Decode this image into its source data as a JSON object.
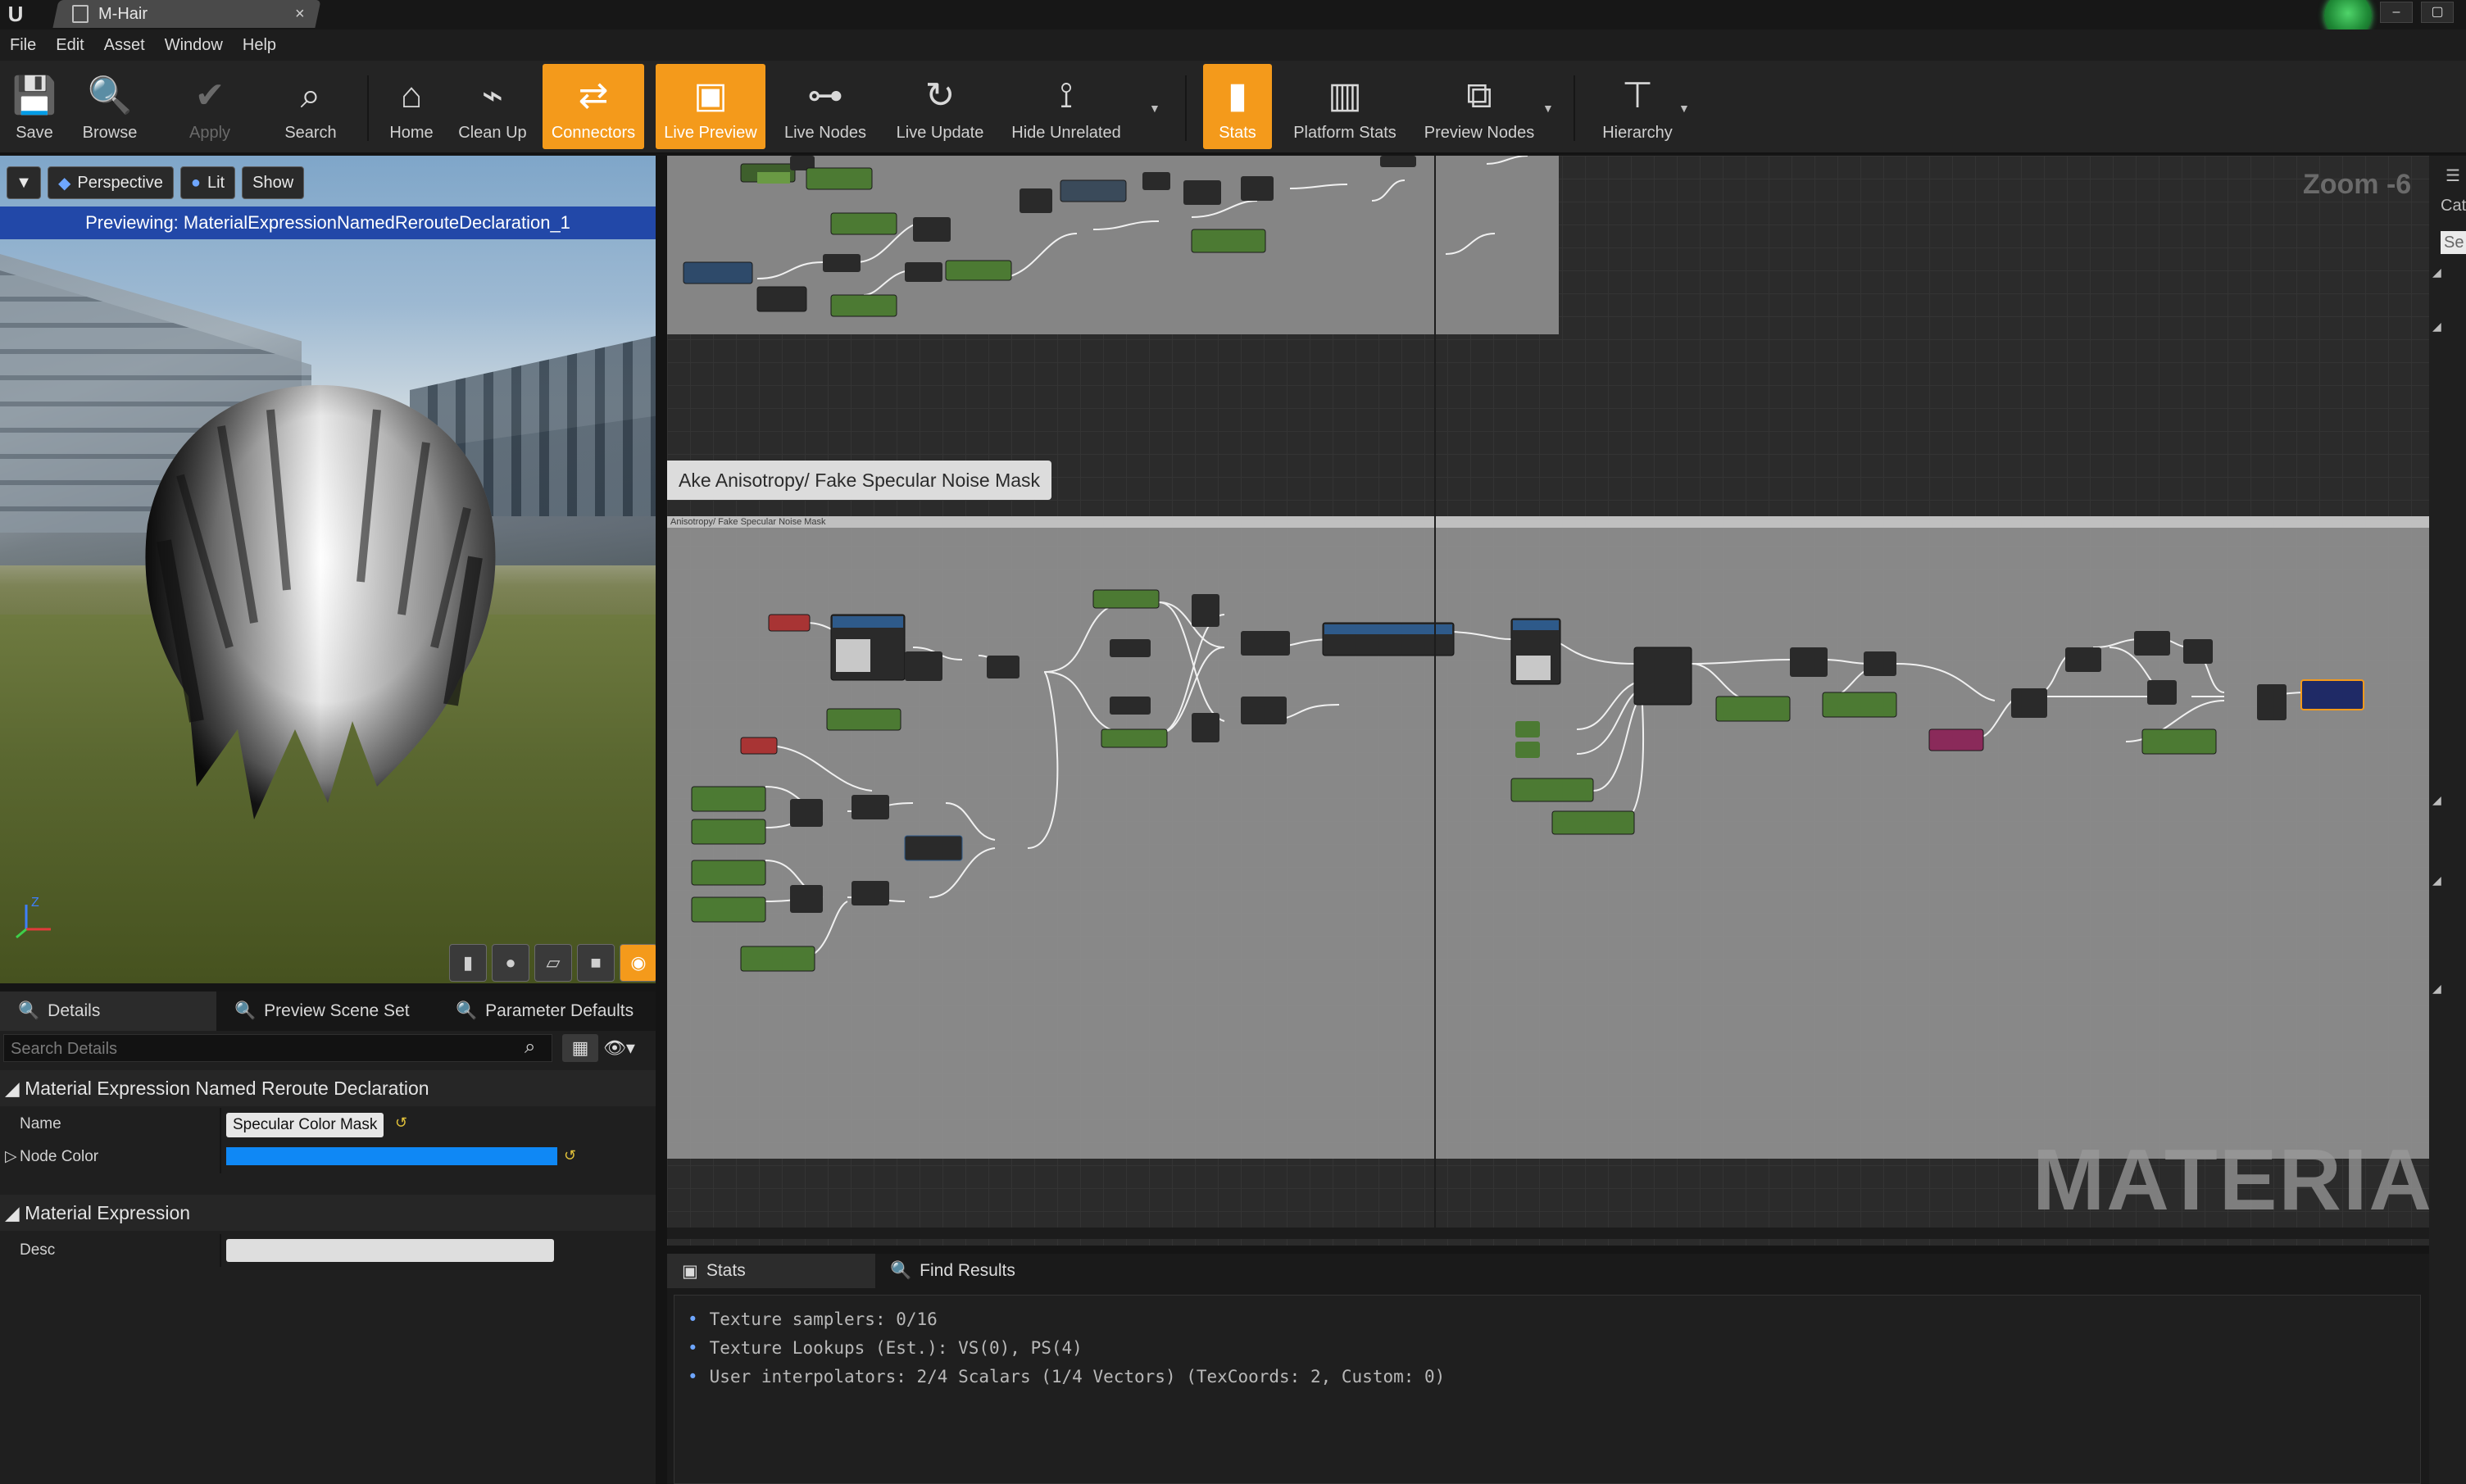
{
  "window": {
    "tab_title": "M-Hair",
    "close_glyph": "×"
  },
  "menu": [
    "File",
    "Edit",
    "Asset",
    "Window",
    "Help"
  ],
  "toolbar": [
    {
      "label": "Save",
      "icon": "save-icon",
      "state": "normal"
    },
    {
      "label": "Browse",
      "icon": "browse-icon",
      "state": "normal"
    },
    {
      "label": "Apply",
      "icon": "apply-icon",
      "state": "disabled"
    },
    {
      "label": "Search",
      "icon": "search-icon",
      "state": "normal"
    },
    {
      "label": "Home",
      "icon": "home-icon",
      "state": "normal"
    },
    {
      "label": "Clean Up",
      "icon": "clean-up-icon",
      "state": "normal"
    },
    {
      "label": "Connectors",
      "icon": "connectors-icon",
      "state": "active"
    },
    {
      "label": "Live Preview",
      "icon": "live-preview-icon",
      "state": "active"
    },
    {
      "label": "Live Nodes",
      "icon": "live-nodes-icon",
      "state": "normal"
    },
    {
      "label": "Live Update",
      "icon": "live-update-icon",
      "state": "normal"
    },
    {
      "label": "Hide Unrelated",
      "icon": "hide-unrelated-icon",
      "state": "normal"
    },
    {
      "label": "Stats",
      "icon": "stats-icon",
      "state": "active"
    },
    {
      "label": "Platform Stats",
      "icon": "platform-stats-icon",
      "state": "normal"
    },
    {
      "label": "Preview Nodes",
      "icon": "preview-nodes-icon",
      "state": "normal"
    },
    {
      "label": "Hierarchy",
      "icon": "hierarchy-icon",
      "state": "normal"
    }
  ],
  "viewport": {
    "perspective": "Perspective",
    "lit": "Lit",
    "show": "Show",
    "previewing": "Previewing: MaterialExpressionNamedRerouteDeclaration_1",
    "axis_label": "Z"
  },
  "details": {
    "tabs": [
      "Details",
      "Preview Scene Set",
      "Parameter Defaults"
    ],
    "search_placeholder": "Search Details",
    "category1": "Material Expression Named Reroute Declaration",
    "name_label": "Name",
    "name_value": "Specular Color Mask",
    "node_color_label": "Node Color",
    "node_color": "#0f88f5",
    "category2": "Material Expression",
    "desc_label": "Desc"
  },
  "graph": {
    "zoom": "Zoom -6",
    "comment_label": "Ake Anisotropy/ Fake Specular Noise Mask",
    "comment_sub": "Anisotropy/ Fake Specular Noise Mask",
    "watermark": "MATERIAL"
  },
  "stats": {
    "tabs": [
      "Stats",
      "Find Results"
    ],
    "lines": [
      "Texture samplers: 0/16",
      "Texture Lookups (Est.): VS(0), PS(4)",
      "User interpolators: 2/4 Scalars (1/4 Vectors) (TexCoords: 2, Custom: 0)"
    ]
  },
  "right_panel": {
    "header": "Cat",
    "search_stub": "Se"
  },
  "colors": {
    "accent_orange": "#f49a1b",
    "preview_bar_blue": "#2248a8",
    "node_param_green": "#5d8a3a",
    "node_red": "#a83434"
  }
}
